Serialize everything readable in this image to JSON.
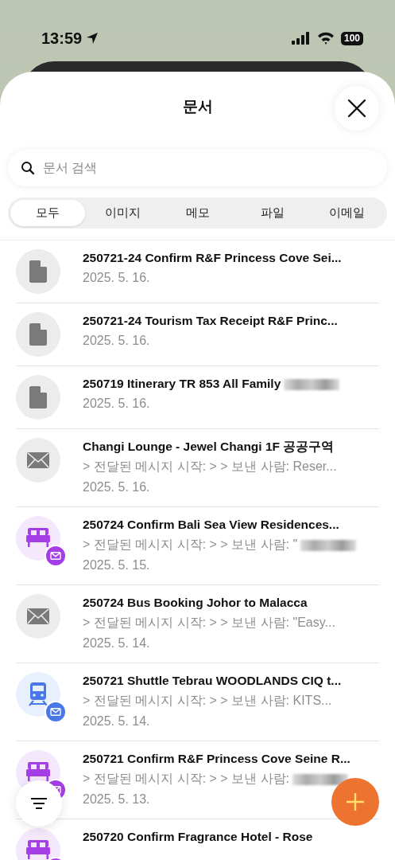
{
  "status_bar": {
    "time": "13:59",
    "battery": "100"
  },
  "header": {
    "title": "문서"
  },
  "search": {
    "placeholder": "문서 검색"
  },
  "tabs": [
    {
      "label": "모두",
      "selected": true
    },
    {
      "label": "이미지",
      "selected": false
    },
    {
      "label": "메모",
      "selected": false
    },
    {
      "label": "파일",
      "selected": false
    },
    {
      "label": "이메일",
      "selected": false
    }
  ],
  "documents": [
    {
      "kind": "file",
      "title": "250721-24 Confirm R&F Princess Cove Sei...",
      "date": "2025. 5. 16.",
      "redacted": false
    },
    {
      "kind": "file",
      "title": "250721-24 Tourism Tax Receipt R&F Princ...",
      "date": "2025. 5. 16.",
      "redacted": false
    },
    {
      "kind": "file",
      "title": "250719 Itinerary TR 853 All Family",
      "date": "2025. 5. 16.",
      "redacted": true
    },
    {
      "kind": "mail",
      "title": "Changi Lounge - Jewel Changi 1F 공공구역",
      "preview": "> 전달된 메시지 시작: > > 보낸 사람: Reser...",
      "date": "2025. 5. 16.",
      "redacted": false
    },
    {
      "kind": "stay",
      "title": "250724 Confirm Bali Sea View Residences...",
      "preview": "> 전달된 메시지 시작: > > 보낸 사람: \"",
      "date": "2025. 5. 15.",
      "redacted": true
    },
    {
      "kind": "mail",
      "title": "250724 Bus Booking Johor to Malacca",
      "preview": "> 전달된 메시지 시작: > > 보낸 사람: \"Easy...",
      "date": "2025. 5. 14.",
      "redacted": false
    },
    {
      "kind": "train",
      "title": "250721 Shuttle Tebrau WOODLANDS CIQ t...",
      "preview": "> 전달된 메시지 시작: > > 보낸 사람: KITS...",
      "date": "2025. 5. 14.",
      "redacted": false
    },
    {
      "kind": "stay",
      "title": "250721 Confirm R&F Princess Cove Seine R...",
      "preview": "> 전달된 메시지 시작: > > 보낸 사람:",
      "date": "2025. 5. 13.",
      "redacted": true
    },
    {
      "kind": "stay",
      "title": "250720 Confirm Fragrance Hotel - Rose",
      "redacted": false
    }
  ]
}
